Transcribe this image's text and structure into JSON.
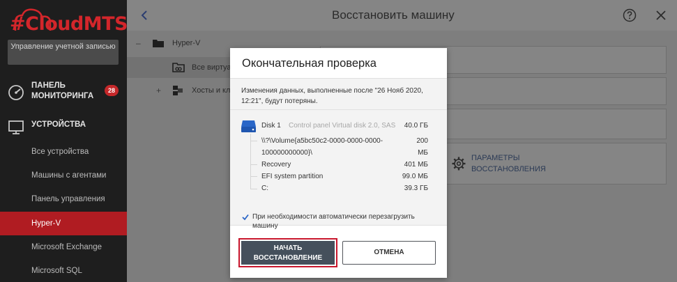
{
  "app": {
    "brand": "#CloudMTS"
  },
  "colors": {
    "brand_red": "#d3262b",
    "active_nav": "#b01c22",
    "primary_btn": "#45505c",
    "highlight_frame": "#c8162c",
    "badge": "#c5282a"
  },
  "sidebar": {
    "account_label": "Управление учетной записью",
    "monitoring": {
      "label": "ПАНЕЛЬ МОНИТОРИНГА",
      "badge": "28",
      "icon": "dashboard-gauge-icon"
    },
    "devices": {
      "label": "УСТРОЙСТВА",
      "icon": "monitor-icon"
    },
    "items": [
      {
        "label": "Все устройства"
      },
      {
        "label": "Машины с агентами"
      },
      {
        "label": "Панель управления"
      },
      {
        "label": "Hyper-V",
        "active": true
      },
      {
        "label": "Microsoft Exchange"
      },
      {
        "label": "Microsoft SQL"
      }
    ]
  },
  "tree": {
    "nodes": [
      {
        "toggle": "–",
        "label": "Hyper-V",
        "icon": "folder-icon"
      },
      {
        "label": "Все виртуа",
        "icon": "vm-group-icon"
      },
      {
        "toggle": "+",
        "label": "Хосты и кл",
        "icon": "cluster-icon"
      }
    ]
  },
  "panel": {
    "title": "Восстановить машину",
    "recovery_params": "ПАРАМЕТРЫ ВОССТАНОВЛЕНИЯ"
  },
  "modal": {
    "title": "Окончательная проверка",
    "warning": "Изменения данных, выполненные после \"26 Нояб 2020, 12:21\", будут потеряны.",
    "disk": {
      "name": "Disk 1",
      "description": "Control panel Virtual disk 2.0, SAS",
      "size": "40.0 ГБ",
      "partitions": [
        {
          "name": "\\\\?\\Volume{a5bc50c2-0000-0000-0000-",
          "size": "200"
        },
        {
          "name": "100000000000}\\",
          "size": "МБ"
        },
        {
          "name": "Recovery",
          "size": "401 МБ"
        },
        {
          "name": "EFI system partition",
          "size": "99.0 МБ"
        },
        {
          "name": "C:",
          "size": "39.3 ГБ"
        }
      ]
    },
    "reboot_label": "При необходимости автоматически перезагрузить машину",
    "reboot_checked": true,
    "start_label": "НАЧАТЬ ВОССТАНОВЛЕНИЕ",
    "cancel_label": "ОТМЕНА"
  }
}
